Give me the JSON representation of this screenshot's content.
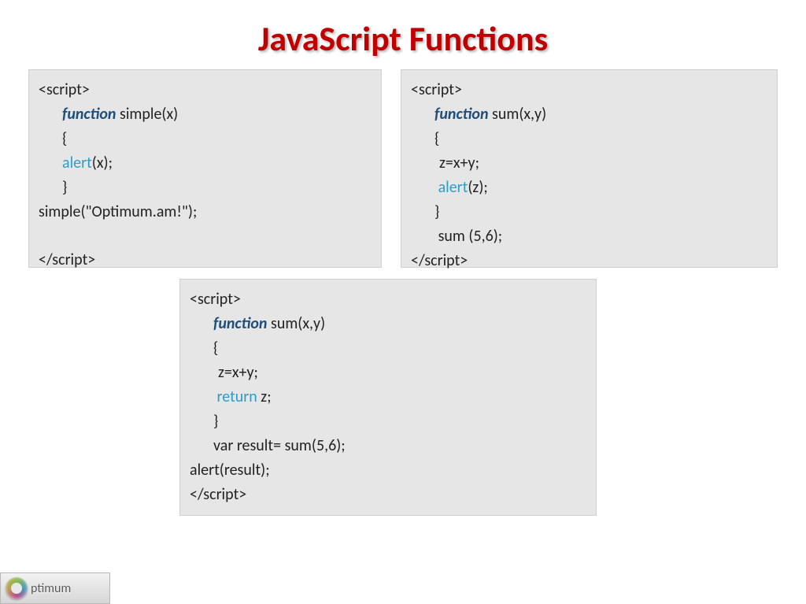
{
  "title": "JavaScript Functions",
  "box1": {
    "l1": "<script>",
    "l2_kw": "function",
    "l2_rest": " simple(x)",
    "l3": "{",
    "l4_fn": "alert",
    "l4_rest": "(x);",
    "l5": "}",
    "l6": "simple(\"Optimum.am!\");",
    "l7": "</script>"
  },
  "box2": {
    "l1": "<script>",
    "l2_kw": "function",
    "l2_rest": " sum(x,y)",
    "l3": "{",
    "l4": "z=x+y;",
    "l5_fn": "alert",
    "l5_rest": "(z);",
    "l6": "}",
    "l7": "sum (5,6);",
    "l8": "</script>"
  },
  "box3": {
    "l1": "<script>",
    "l2_kw": "function",
    "l2_rest": " sum(x,y)",
    "l3": "{",
    "l4": "z=x+y;",
    "l5_fn": "return",
    "l5_rest": " z;",
    "l6": "}",
    "l7": "var  result= sum(5,6);",
    "l8": "alert(result);",
    "l9": "</script>"
  },
  "logo": {
    "text": "ptimum"
  }
}
